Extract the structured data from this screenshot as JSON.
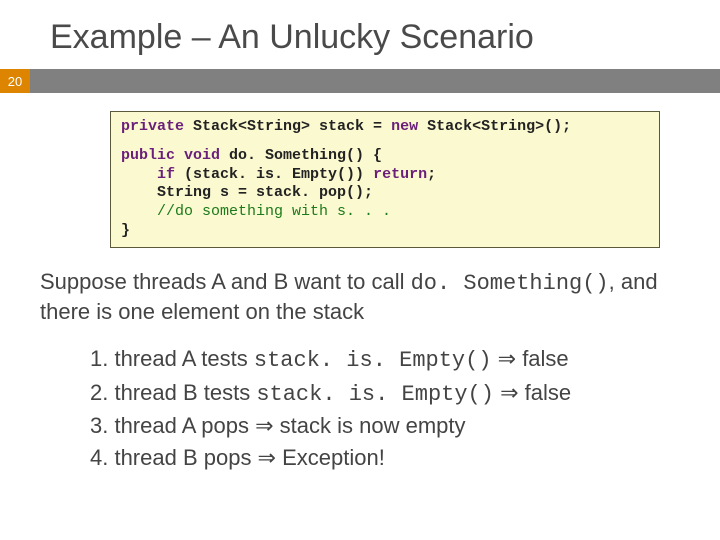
{
  "title": "Example – An Unlucky Scenario",
  "slide_number": "20",
  "code": {
    "l1a": "private",
    "l1b": " Stack<String> stack = ",
    "l1c": "new",
    "l1d": " Stack<String>();",
    "l2a": "public void",
    "l2b": " do. Something() {",
    "l3a": "    if",
    "l3b": " (stack. is. Empty()) ",
    "l3c": "return",
    "l3d": ";",
    "l4": "    String s = stack. pop();",
    "l5": "    //do something with s. . .",
    "l6": "}"
  },
  "para": {
    "p1": "Suppose threads A and B want to call ",
    "p2": "do. Something()",
    "p3": ", and there is one element on the stack"
  },
  "steps": {
    "s1a": "1. thread A tests ",
    "s1b": "stack. is. Empty()",
    "s1c": " ⇒  false",
    "s2a": "2. thread B tests ",
    "s2b": "stack. is. Empty()",
    "s2c": " ⇒  false",
    "s3": "3. thread A pops ⇒ stack is now empty",
    "s4": "4. thread B pops ⇒ Exception!"
  }
}
